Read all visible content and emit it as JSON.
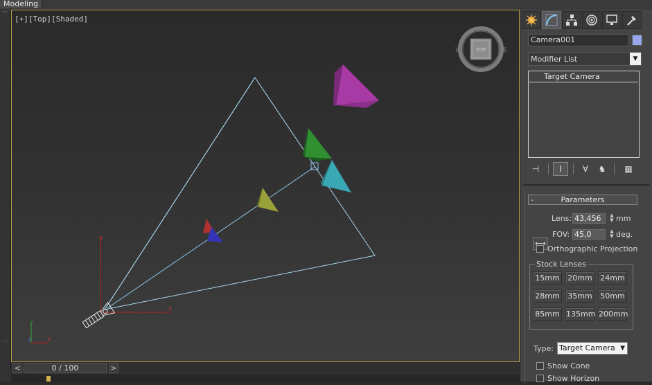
{
  "ribbon": {
    "active_tab": "Modeling"
  },
  "viewport": {
    "label": "[+][Top][Shaded]",
    "viewcube_face": "TOP",
    "viewcube_west": "W",
    "viewcube_east": "E",
    "axis_x": "x",
    "axis_y": "y"
  },
  "timeline": {
    "position": "0 / 100",
    "prev": "<",
    "next": ">"
  },
  "command_panel": {
    "tabs": [
      "create-icon",
      "modify-icon",
      "hierarchy-icon",
      "motion-icon",
      "display-icon",
      "utilities-icon"
    ],
    "object_name": "Camera001",
    "object_color": "#97a7ea",
    "modifier_list": "Modifier List",
    "stack_item": "Target Camera",
    "parameters": {
      "title": "Parameters",
      "collapse": "-",
      "lens_label": "Lens:",
      "lens_value": "43,456",
      "lens_unit": "mm",
      "fov_label": "FOV:",
      "fov_value": "45,0",
      "fov_unit": "deg.",
      "ortho_label": "Orthographic Projection",
      "stock_title": "Stock Lenses",
      "lenses": [
        "15mm",
        "20mm",
        "24mm",
        "28mm",
        "35mm",
        "50mm",
        "85mm",
        "135mm",
        "200mm"
      ],
      "type_label": "Type:",
      "type_value": "Target Camera",
      "show_cone": "Show Cone",
      "show_horizon": "Show Horizon"
    }
  }
}
